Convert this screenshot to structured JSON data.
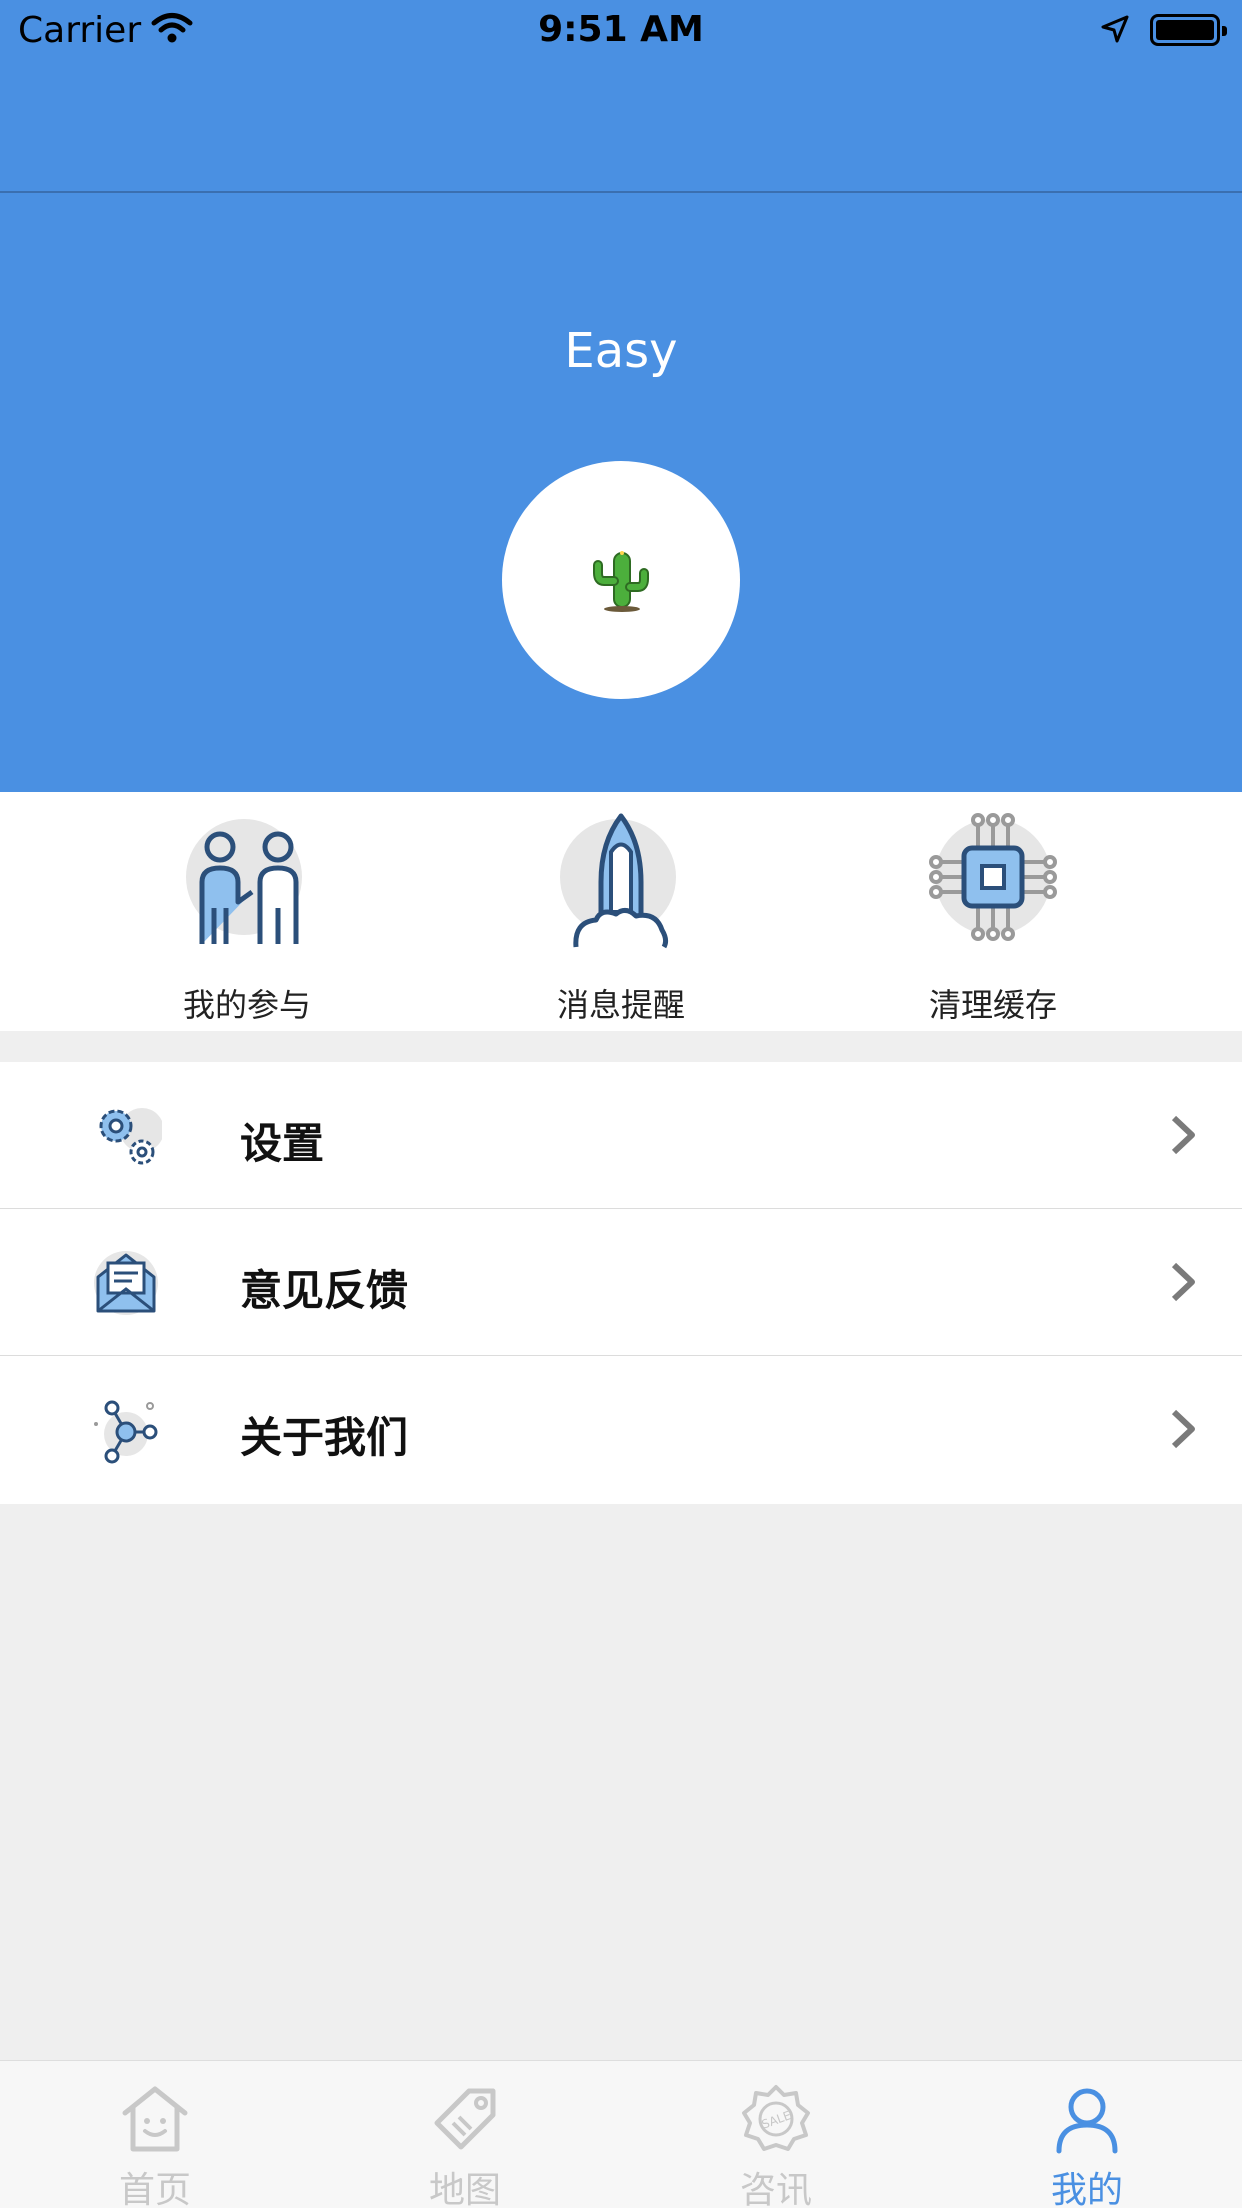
{
  "status_bar": {
    "carrier": "Carrier",
    "time": "9:51 AM"
  },
  "profile": {
    "username": "Easy",
    "avatar_icon": "cactus-icon"
  },
  "quick_actions": [
    {
      "label": "我的参与",
      "icon": "people-icon"
    },
    {
      "label": "消息提醒",
      "icon": "rocket-icon"
    },
    {
      "label": "清理缓存",
      "icon": "chip-icon"
    }
  ],
  "menu": [
    {
      "label": "设置",
      "icon": "gear-icon"
    },
    {
      "label": "意见反馈",
      "icon": "envelope-icon"
    },
    {
      "label": "关于我们",
      "icon": "network-icon"
    }
  ],
  "tabs": [
    {
      "label": "首页",
      "icon": "home-icon",
      "active": false
    },
    {
      "label": "地图",
      "icon": "tag-icon",
      "active": false
    },
    {
      "label": "咨讯",
      "icon": "sale-badge-icon",
      "active": false
    },
    {
      "label": "我的",
      "icon": "person-icon",
      "active": true
    }
  ],
  "colors": {
    "accent": "#4a90e2",
    "tab_inactive": "#c8c8c8",
    "background": "#efefef"
  }
}
